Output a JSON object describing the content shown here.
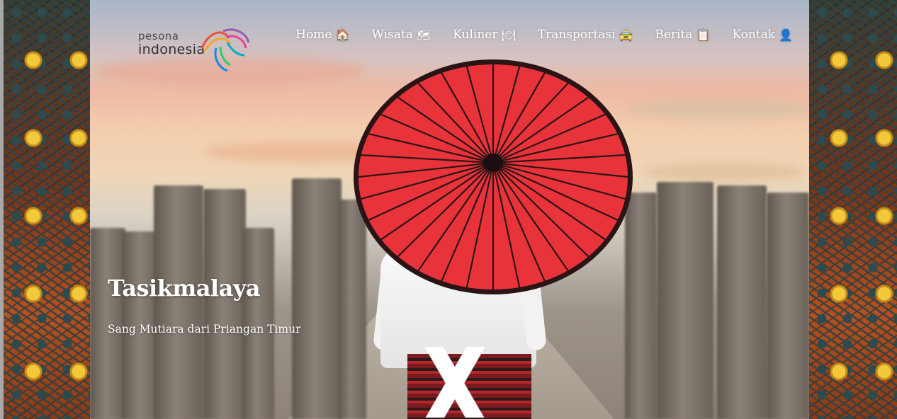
{
  "brand": {
    "line1": "pesona",
    "line2": "indonesia"
  },
  "nav": [
    {
      "label": "Home",
      "emoji": "🏠"
    },
    {
      "label": "Wisata",
      "emoji": "🗺"
    },
    {
      "label": "Kuliner",
      "emoji": "🍽"
    },
    {
      "label": "Transportasi",
      "emoji": "🚖"
    },
    {
      "label": "Berita",
      "emoji": "📋"
    },
    {
      "label": "Kontak",
      "emoji": "👤"
    }
  ],
  "hero": {
    "title": "Tasikmalaya",
    "subtitle": "Sang Mutiara dari Priangan Timur"
  },
  "colors": {
    "umbrella": "#e8333b",
    "umbrella_ribs": "#2a1416",
    "nav_text": "#ffffff"
  }
}
